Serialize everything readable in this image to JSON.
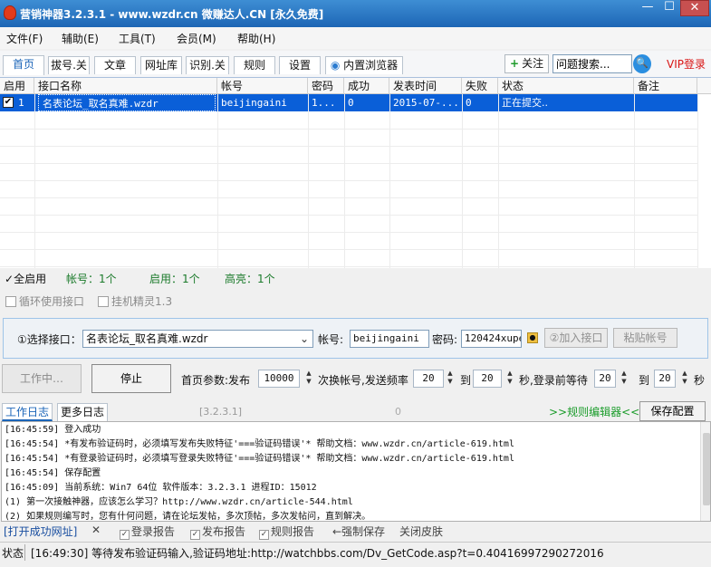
{
  "window": {
    "title": "营销神器3.2.3.1 - www.wzdr.cn 微赚达人.CN [永久免费]",
    "min": "—",
    "max": "☐",
    "close": "✕"
  },
  "menu": [
    "文件(F)",
    "辅助(E)",
    "工具(T)",
    "会员(M)",
    "帮助(H)"
  ],
  "tabs": [
    "首页",
    "拔号.关",
    "文章",
    "网址库",
    "识别.关",
    "规则",
    "设置",
    "内置浏览器"
  ],
  "toolbar": {
    "follow": "关注",
    "search_value": "问题搜索...",
    "vip": "VIP登录"
  },
  "grid": {
    "columns": [
      "启用",
      "接口名称",
      "帐号",
      "密码",
      "成功",
      "发表时间",
      "失败",
      "状态",
      "备注"
    ],
    "rows": [
      {
        "enabled": "✔",
        "index": "1",
        "name": "名表论坛_取名真难.wzdr",
        "account": "beijingaini",
        "password": "1...",
        "success": "0",
        "time": "2015-07-...",
        "fail": "0",
        "status": "正在提交..",
        "note": ""
      }
    ]
  },
  "summary": {
    "all": "全启用",
    "accounts": "帐号：1个",
    "enabled": "启用：1个",
    "priority": "高亮：1个"
  },
  "options": {
    "loop": "循环使用接口",
    "assist": "挂机精灵1.3"
  },
  "iface": {
    "select_label": "①选择接口：",
    "select_value": "名表论坛_取名真难.wzdr",
    "account_label": "帐号:",
    "account_value": "beijingaini",
    "password_label": "密码:",
    "password_value": "120424xuper",
    "add_btn": "②加入接口",
    "paste_btn": "粘贴帐号"
  },
  "control": {
    "work_btn": "工作中…",
    "stop_btn": "停止",
    "params_label": "首页参数:发布",
    "pub_count": "10000",
    "switch_label": "次换帐号,发送频率",
    "freq_a": "20",
    "to1": "到",
    "freq_b": "20",
    "sec_login": "秒,登录前等待",
    "wait_a": "20",
    "to2": "到",
    "wait_b": "20",
    "sec": "秒"
  },
  "log": {
    "tabs": [
      "工作日志",
      "更多日志"
    ],
    "version": "[3.2.3.1]",
    "count": "0",
    "rule_editor": ">>规则编辑器<<",
    "save_btn": "保存配置",
    "lines": [
      "[16:45:59] 登入成功",
      "[16:45:54] *有发布验证码时，必须填写发布失败特征'===验证码错误'* 帮助文档：www.wzdr.cn/article-619.html",
      "[16:45:54] *有登录验证码时，必须填写登录失败特征'===验证码错误'* 帮助文档：www.wzdr.cn/article-619.html",
      "[16:45:54] 保存配置",
      "[16:45:09] 当前系统：Win7 64位 软件版本：3.2.3.1 进程ID：15012",
      "(1) 第一次接触神器，应该怎么学习？http://www.wzdr.cn/article-544.html",
      "(2) 如果规则编写时，您有什何问题，请在论坛发帖，多次顶帖，多次发帖问，直到解决。"
    ]
  },
  "bottom": {
    "open_url": "[打开成功网址]",
    "x": "✕",
    "login_report": "登录报告",
    "publish_report": "发布报告",
    "rule_report": "规则报告",
    "force_save": "←强制保存",
    "close_skin": "关闭皮肤"
  },
  "status": {
    "label": "状态",
    "text": "[16:49:30] 等待发布验证码输入,验证码地址:http://watchbbs.com/Dv_GetCode.asp?t=0.40416997290272016"
  }
}
